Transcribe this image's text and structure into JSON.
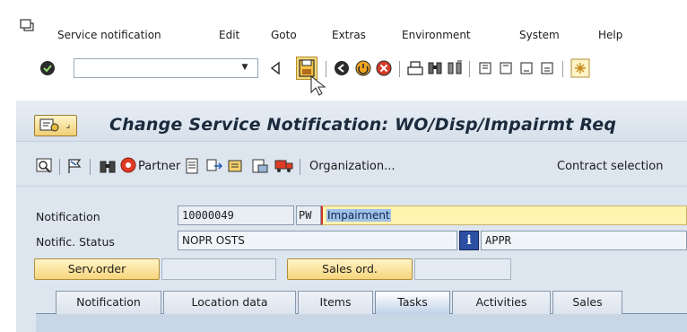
{
  "menu": {
    "items": [
      "Service notification",
      "Edit",
      "Goto",
      "Extras",
      "Environment",
      "System",
      "Help"
    ]
  },
  "toolbar": {
    "command_field_value": "",
    "icons": [
      "enter-icon",
      "dropdown-icon",
      "back-icon",
      "save-icon",
      "back-green-icon",
      "exit-icon",
      "cancel-icon",
      "print-icon",
      "find-icon",
      "find-next-icon",
      "first-page-icon",
      "previous-page-icon",
      "next-page-icon",
      "last-page-icon",
      "create-session-icon"
    ]
  },
  "title": {
    "text": "Change Service Notification: WO/Disp/Impairmt Req"
  },
  "app_toolbar": {
    "partner_label": "Partner",
    "organization_label": "Organization...",
    "contract_selection_label": "Contract selection"
  },
  "form": {
    "notification_label": "Notification",
    "notification_number": "10000049",
    "notification_type": "PW",
    "notification_description": "Impairment",
    "status_label": "Notific. Status",
    "status_value": "NOPR OSTS",
    "status_info_value": "APPR",
    "service_order_button": "Serv.order",
    "service_order_value": "",
    "sales_order_button": "Sales ord.",
    "sales_order_value": ""
  },
  "tabs": [
    {
      "label": "Notification",
      "active": false
    },
    {
      "label": "Location data",
      "active": false
    },
    {
      "label": "Items",
      "active": false
    },
    {
      "label": "Tasks",
      "active": true
    },
    {
      "label": "Activities",
      "active": false
    },
    {
      "label": "Sales",
      "active": false
    }
  ],
  "colors": {
    "background": "#dde5ef",
    "button_yellow": "#f6d57d",
    "field_yellow": "#fff3b0",
    "active_tab": "#bfd2e8"
  }
}
